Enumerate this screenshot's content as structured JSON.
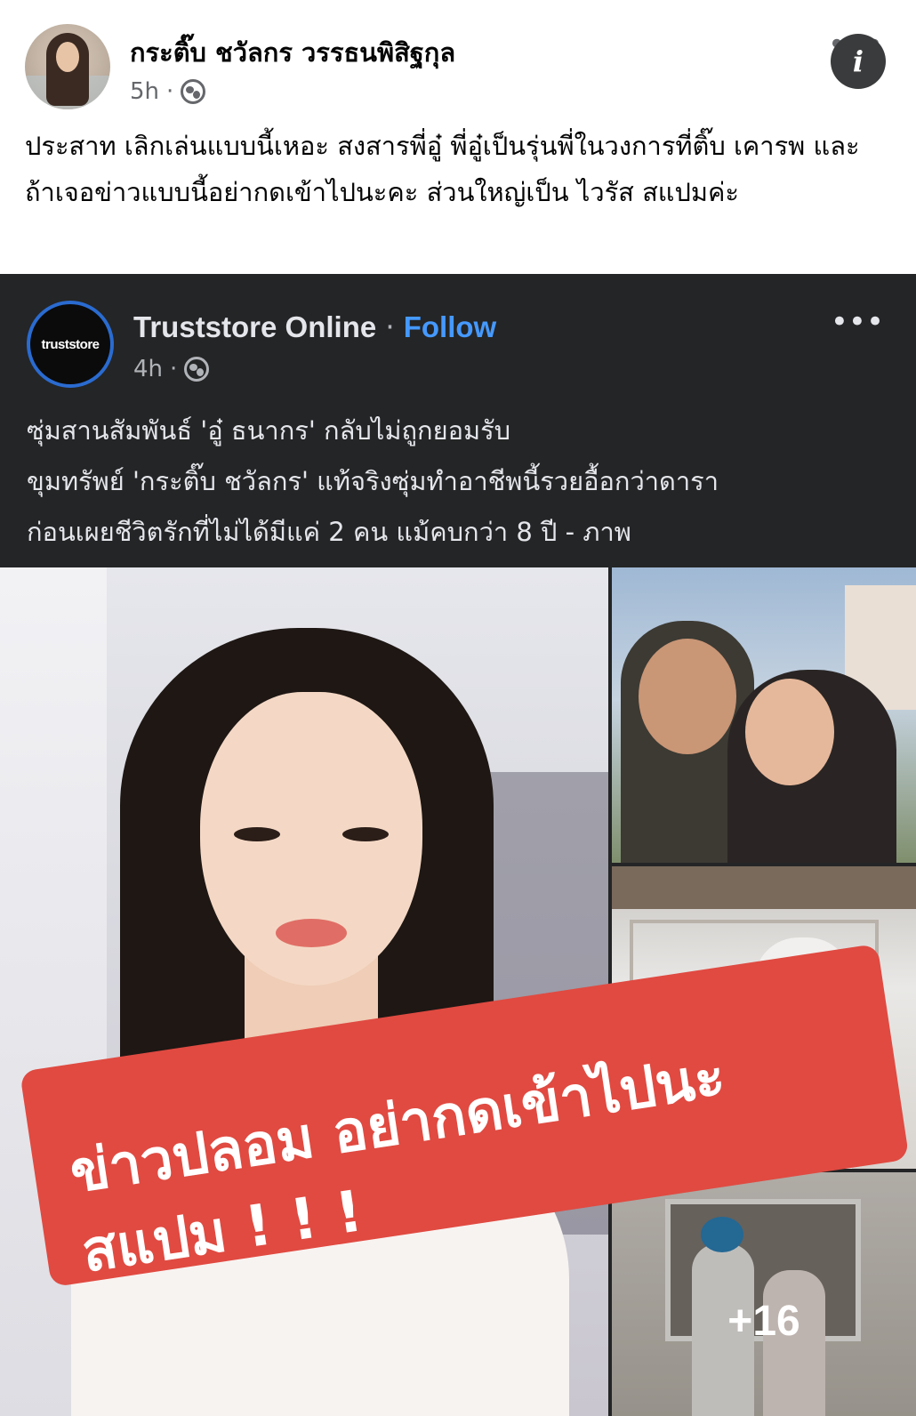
{
  "post": {
    "author": "กระติ๊บ ชวัลกร วรรธนพิสิฐกุล",
    "time": "5h",
    "text": "ประสาท เลิกเล่นแบบนี้เหอะ สงสารพี่อู๋ พี่อู๋เป็นรุ่นพี่ในวงการที่ติ๊บ เคารพ และ ถ้าเจอข่าวแบบนี้อย่ากดเข้าไปนะคะ ส่วนใหญ่เป็น ไวรัส สแปมค่ะ",
    "more_icon": "more-horizontal-icon",
    "privacy_icon": "globe-icon"
  },
  "shared_post": {
    "page_name": "Truststore Online",
    "separator": "·",
    "follow_label": "Follow",
    "time": "4h",
    "logo_text": "truststore",
    "text_lines": [
      "ซุ่มสานสัมพันธ์ 'อู๋ ธนากร' กลับไม่ถูกยอมรับ",
      "ขุมทรัพย์ 'กระติ๊บ ชวัลกร' แท้จริงซุ่มทำอาชีพนี้รวยอื้อกว่าดารา",
      "ก่อนเผยชีวิตรักที่ไม่ได้มีแค่ 2 คน แม้คบกว่า 8 ปี - ภาพ"
    ],
    "photo_count_label": "+16",
    "info_icon_glyph": "i"
  },
  "banner": {
    "line1": "ข่าวปลอม  อย่ากดเข้าไปนะ",
    "line2": "สแปม ! ! !",
    "color": "#e04a41"
  },
  "colors": {
    "shared_bg": "#242526",
    "follow_blue": "#4599ff"
  }
}
